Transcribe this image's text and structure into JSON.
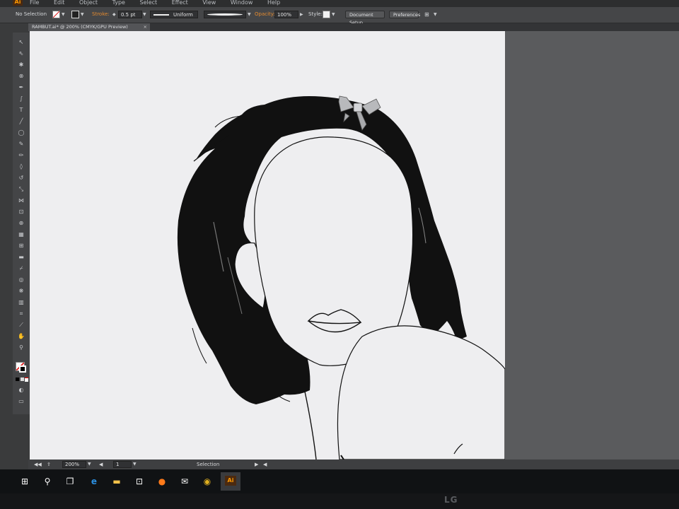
{
  "app": {
    "logo": "Ai"
  },
  "menu": [
    "File",
    "Edit",
    "Object",
    "Type",
    "Select",
    "Effect",
    "View",
    "Window",
    "Help"
  ],
  "controlbar": {
    "selection": "No Selection",
    "stroke_label": "Stroke:",
    "stroke_weight": "0.5 pt",
    "profile": "Uniform",
    "opacity_label": "Opacity:",
    "opacity": "100%",
    "style_label": "Style:",
    "document_setup": "Document Setup",
    "preferences": "Preferences"
  },
  "tab": {
    "title": "RAMBUT.ai* @ 200% (CMYK/GPU Preview)",
    "close": "×"
  },
  "status": {
    "zoom": "200%",
    "page": "1",
    "tool": "Selection"
  },
  "tools": [
    "selection-tool",
    "direct-selection-tool",
    "magic-wand-tool",
    "lasso-tool",
    "pen-tool",
    "curvature-tool",
    "type-tool",
    "line-tool",
    "rectangle-tool",
    "paintbrush-tool",
    "pencil-tool",
    "eraser-tool",
    "rotate-tool",
    "scale-tool",
    "width-tool",
    "free-transform-tool",
    "shape-builder-tool",
    "perspective-tool",
    "mesh-tool",
    "gradient-tool",
    "eyedropper-tool",
    "blend-tool",
    "symbol-sprayer-tool",
    "column-graph-tool",
    "artboard-tool",
    "slice-tool",
    "hand-tool",
    "zoom-tool"
  ],
  "colors": {
    "accent": "#e58b2f",
    "artboard": "#eeeef0",
    "ink": "#111111"
  },
  "brand": "LG"
}
